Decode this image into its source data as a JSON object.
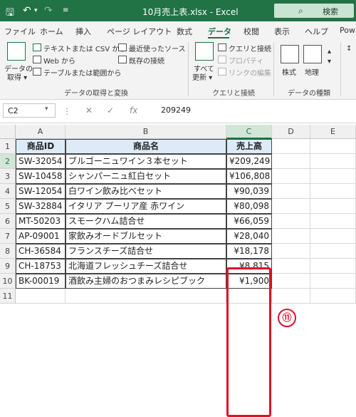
{
  "titlebar": {
    "title": "10月売上表.xlsx  -  Excel",
    "search_label": "検索"
  },
  "tabs": [
    {
      "label": "ファイル",
      "name": "tab-file"
    },
    {
      "label": "ホーム",
      "name": "tab-home"
    },
    {
      "label": "挿入",
      "name": "tab-insert"
    },
    {
      "label": "ページ レイアウト",
      "name": "tab-page-layout"
    },
    {
      "label": "数式",
      "name": "tab-formulas"
    },
    {
      "label": "データ",
      "name": "tab-data"
    },
    {
      "label": "校閲",
      "name": "tab-review"
    },
    {
      "label": "表示",
      "name": "tab-view"
    },
    {
      "label": "ヘルプ",
      "name": "tab-help"
    },
    {
      "label": "Pow",
      "name": "tab-power"
    }
  ],
  "ribbon": {
    "get_data": "データの\n取得",
    "get_data_l1": "データの",
    "get_data_l2": "取得 ▾",
    "from_text_csv": "テキストまたは CSV から",
    "from_web": "Web から",
    "from_table": "テーブルまたは範囲から",
    "recent_sources": "最近使ったソース",
    "existing_connections": "既存の接続",
    "group_get_transform": "データの取得と変換",
    "refresh_all_l1": "すべて",
    "refresh_all_l2": "更新 ▾",
    "queries_connections": "クエリと接続",
    "properties": "プロパティ",
    "edit_links": "リンクの編集",
    "group_queries": "クエリと接続",
    "stocks": "株式",
    "geography": "地理",
    "group_data_types": "データの種類"
  },
  "formula_bar": {
    "cell_ref": "C2",
    "value": "209249"
  },
  "columns": [
    "A",
    "B",
    "C",
    "D",
    "E"
  ],
  "rows": [
    "1",
    "2",
    "3",
    "4",
    "5",
    "6",
    "7",
    "8",
    "9",
    "10",
    "11"
  ],
  "table": {
    "headers": [
      "商品ID",
      "商品名",
      "売上高"
    ],
    "data": [
      [
        "SW-32054",
        "ブルゴーニュワイン３本セット",
        "¥209,249"
      ],
      [
        "SW-10458",
        "シャンパーニュ紅白セット",
        "¥106,808"
      ],
      [
        "SW-12054",
        "白ワイン飲み比べセット",
        "¥90,039"
      ],
      [
        "SW-32884",
        "イタリア プーリア産 赤ワイン",
        "¥80,098"
      ],
      [
        "MT-50203",
        "スモークハム詰合せ",
        "¥66,059"
      ],
      [
        "AP-09001",
        "家飲みオードブルセット",
        "¥28,040"
      ],
      [
        "CH-36584",
        "フランスチーズ詰合せ",
        "¥18,178"
      ],
      [
        "CH-18753",
        "北海道フレッシュチーズ詰合せ",
        "¥8,815"
      ],
      [
        "BK-00019",
        "酒飲み主婦のおつまみレシピブック",
        "¥1,900"
      ]
    ]
  },
  "callout": "⑪",
  "colors": {
    "excel_green": "#217346",
    "highlight_red": "#e0102a",
    "header_fill": "#dcebf7"
  }
}
